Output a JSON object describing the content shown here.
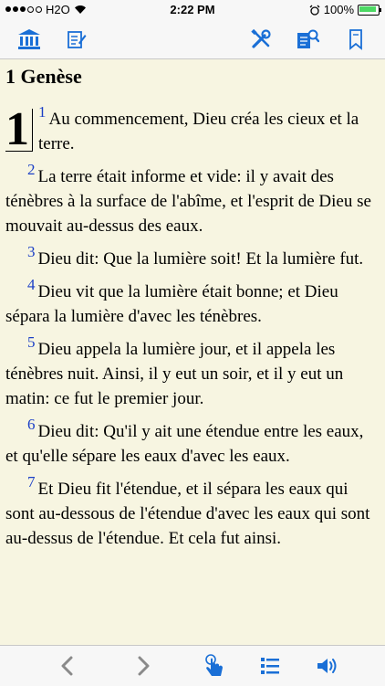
{
  "status": {
    "carrier": "H2O",
    "time": "2:22 PM",
    "battery": "100%"
  },
  "colors": {
    "accent": "#1a6fd6",
    "verse_number": "#1b3fc6",
    "background": "#f7f5e1"
  },
  "toolbar": {
    "icons": [
      "library-icon",
      "notes-icon",
      "tools-icon",
      "search-book-icon",
      "bookmark-icon"
    ]
  },
  "chapter": {
    "title": "1 Genèse",
    "dropcap": "1",
    "verses": [
      {
        "n": "1",
        "text": "Au commencement, Dieu créa les cieux et la terre."
      },
      {
        "n": "2",
        "text": "La terre était informe et vide: il y avait des ténèbres à la surface de l'abîme, et l'esprit de Dieu se mouvait au-dessus des eaux."
      },
      {
        "n": "3",
        "text": "Dieu dit: Que la lumière soit! Et la lumière fut."
      },
      {
        "n": "4",
        "text": "Dieu vit que la lumière était bonne; et Dieu sépara la lumière d'avec les ténèbres."
      },
      {
        "n": "5",
        "text": "Dieu appela la lumière jour, et il appela les ténèbres nuit. Ainsi, il y eut un soir, et il y eut un matin: ce fut le premier jour."
      },
      {
        "n": "6",
        "text": "Dieu dit: Qu'il y ait une étendue entre les eaux, et qu'elle sépare les eaux d'avec les eaux."
      },
      {
        "n": "7",
        "text": "Et Dieu fit l'étendue, et il sépara les eaux qui sont au-dessous de l'étendue d'avec les eaux qui sont au-dessus de l'étendue. Et cela fut ainsi."
      }
    ]
  },
  "bottombar": {
    "icons": [
      "chevron-left-icon",
      "chevron-right-icon",
      "touch-icon",
      "list-icon",
      "speaker-icon"
    ]
  }
}
